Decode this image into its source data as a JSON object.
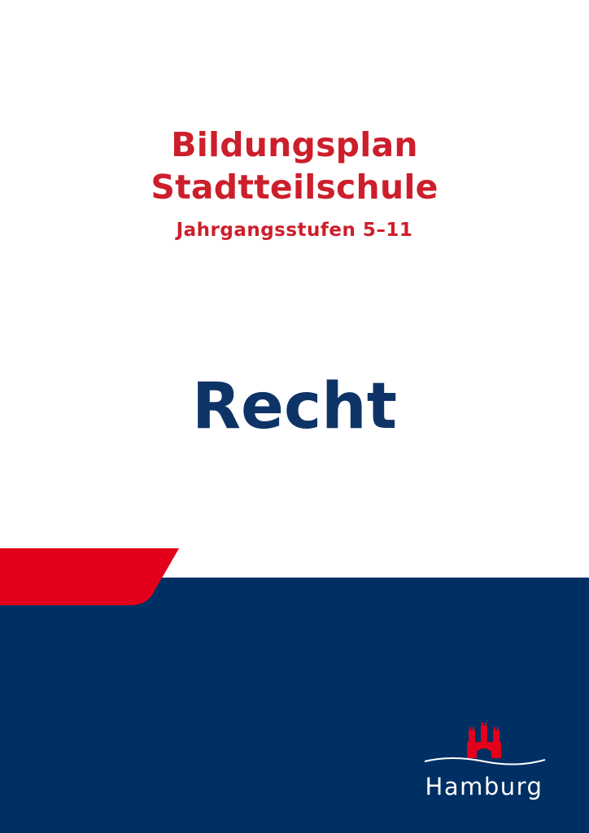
{
  "cover": {
    "title_line1": "Bildungsplan",
    "title_line2": "Stadtteilschule",
    "subtitle": "Jahrgangsstufen 5–11",
    "subject": "Recht"
  },
  "logo": {
    "name": "hamburg-coat-of-arms-icon",
    "wordmark": "Hamburg"
  },
  "colors": {
    "title_red": "#cc1f2b",
    "subject_blue": "#0e3467",
    "band_blue": "#003063",
    "band_red": "#e2001a",
    "logo_red": "#e2001a",
    "white": "#ffffff"
  }
}
